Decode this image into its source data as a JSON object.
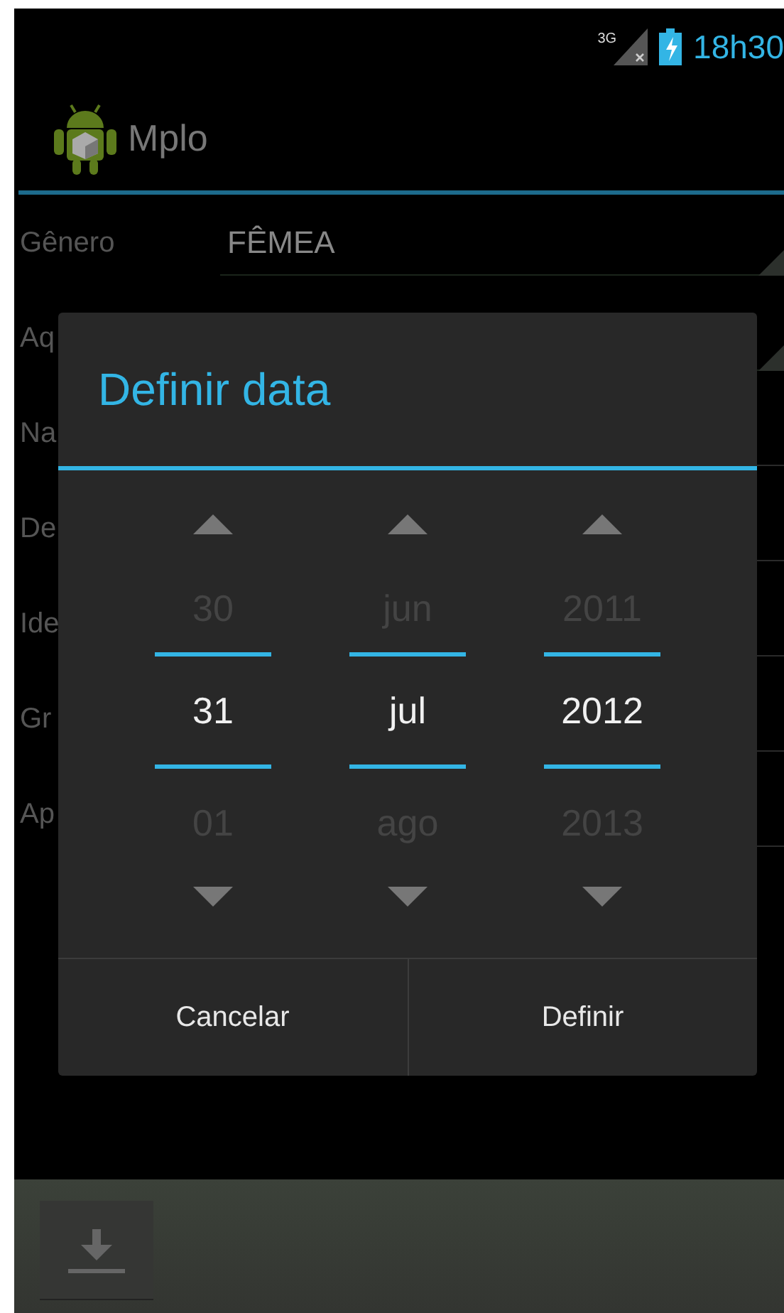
{
  "status_bar": {
    "network": "3G",
    "time": "18h30"
  },
  "action_bar": {
    "title": "Mplo"
  },
  "form": {
    "rows": [
      {
        "label": "Gênero",
        "value": "FÊMEA",
        "kind": "spinner"
      },
      {
        "label": "Aq",
        "kind": "spinner"
      },
      {
        "label": "Na",
        "kind": "text"
      },
      {
        "label": "De",
        "kind": "text"
      },
      {
        "label": "Ide",
        "kind": "text"
      },
      {
        "label": "Gr",
        "kind": "text"
      },
      {
        "label": "Ap",
        "kind": "text"
      }
    ]
  },
  "dialog": {
    "title": "Definir data",
    "pickers": [
      {
        "previous": "30",
        "current": "31",
        "next": "01"
      },
      {
        "previous": "jun",
        "current": "jul",
        "next": "ago"
      },
      {
        "previous": "2011",
        "current": "2012",
        "next": "2013"
      }
    ],
    "buttons": [
      "Cancelar",
      "Definir"
    ]
  }
}
